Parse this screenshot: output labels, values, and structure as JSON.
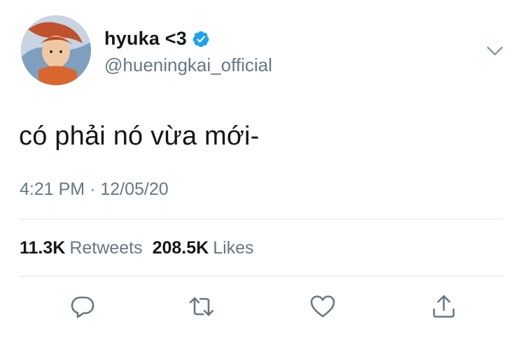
{
  "user": {
    "display_name": "hyuka <3",
    "handle": "@hueningkai_official",
    "verified": true,
    "avatar_icon": "profile-photo"
  },
  "tweet": {
    "text": "có phải nó vừa mới-",
    "time": "4:21 PM",
    "separator": "·",
    "date": "12/05/20"
  },
  "stats": {
    "retweets_count": "11.3K",
    "retweets_label": "Retweets",
    "likes_count": "208.5K",
    "likes_label": "Likes"
  },
  "actions": [
    {
      "icon": "reply-icon"
    },
    {
      "icon": "retweet-icon"
    },
    {
      "icon": "like-icon"
    },
    {
      "icon": "share-icon"
    }
  ],
  "colors": {
    "verified_blue": "#1da1f2",
    "secondary_text": "#657786",
    "primary_text": "#14171a",
    "divider": "#dfe5ea"
  }
}
